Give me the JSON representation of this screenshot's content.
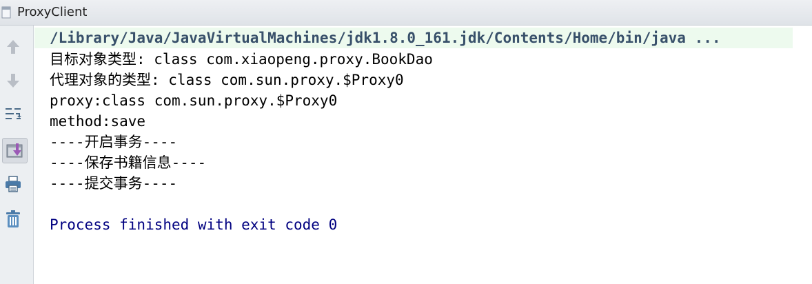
{
  "tab": {
    "title": "ProxyClient"
  },
  "toolbar": {
    "icons": [
      "up-arrow-icon",
      "down-arrow-icon",
      "soft-wrap-icon",
      "scroll-to-end-icon",
      "print-icon",
      "trash-icon"
    ]
  },
  "console": {
    "command_line": "/Library/Java/JavaVirtualMachines/jdk1.8.0_161.jdk/Contents/Home/bin/java ...",
    "lines": [
      "目标对象类型: class com.xiaopeng.proxy.BookDao",
      "代理对象的类型: class com.sun.proxy.$Proxy0",
      "proxy:class com.sun.proxy.$Proxy0",
      "method:save",
      "----开启事务----",
      "----保存书籍信息----",
      "----提交事务----"
    ],
    "finish_message": "Process finished with exit code 0"
  },
  "colors": {
    "command_bg": "#edfaee",
    "command_text": "#38506a",
    "finish_text": "#000080",
    "toolbar_bg": "#eceff2"
  }
}
